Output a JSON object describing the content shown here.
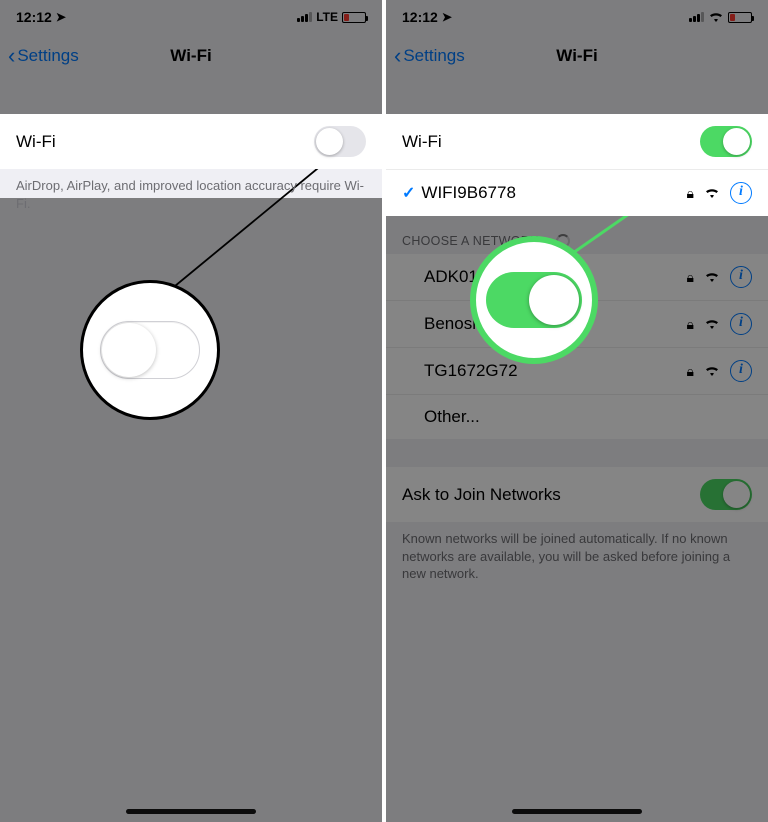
{
  "status": {
    "time": "12:12",
    "carrier_lte": "LTE"
  },
  "nav": {
    "back_label": "Settings",
    "title": "Wi-Fi"
  },
  "left": {
    "wifi_label": "Wi-Fi",
    "disabled_footer": "AirDrop, AirPlay, and improved location accuracy require Wi-Fi."
  },
  "right": {
    "wifi_label": "Wi-Fi",
    "connected_network": "WIFI9B6778",
    "choose_header": "CHOOSE A NETWORK...",
    "networks": [
      {
        "name": "ADK01"
      },
      {
        "name": "Benosid"
      },
      {
        "name": "TG1672G72"
      }
    ],
    "other_label": "Other...",
    "ask_label": "Ask to Join Networks",
    "ask_footer": "Known networks will be joined automatically. If no known networks are available, you will be asked before joining a new network."
  }
}
